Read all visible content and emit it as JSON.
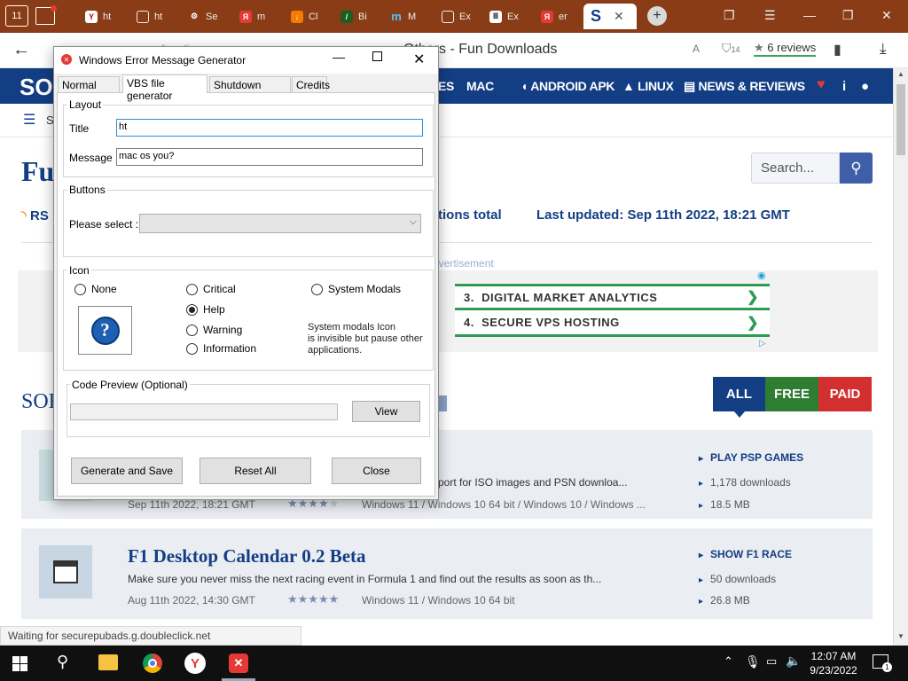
{
  "browser": {
    "tab_count": "11",
    "tabs": [
      "ht",
      "ht",
      "Se",
      "m",
      "Cl",
      "Bi",
      "M",
      "Ex",
      "Ex",
      "er"
    ],
    "address": "softpedia.com",
    "page_title": "Others - Fun Downloads",
    "reviews": "6 reviews",
    "shield_badge": "14"
  },
  "site": {
    "logo": "SO",
    "nav": [
      "ES",
      "MAC",
      "ANDROID APK",
      "LINUX",
      "NEWS & REVIEWS"
    ],
    "subnav_letter": "S",
    "heading": "Fu",
    "search_placeholder": "Search...",
    "rss": "RS",
    "totals": "tions total",
    "last_updated": "Last updated: Sep 11th 2022, 18:21 GMT",
    "advert_label": "Advertisement",
    "ads": [
      {
        "num": "3.",
        "text": "DIGITAL MARKET ANALYTICS"
      },
      {
        "num": "4.",
        "text": "SECURE VPS HOSTING"
      }
    ],
    "sort_label": "SOR",
    "filters": [
      "ALL",
      "FREE",
      "PAID"
    ],
    "items": [
      {
        "title": "",
        "desc": "port for ISO images and PSN downloa...",
        "date": "Sep 11th 2022, 18:21 GMT",
        "rating": 4,
        "platform": "Windows 11 / Windows 10 64 bit / Windows 10 / Windows ...",
        "link": "PLAY PSP GAMES",
        "downloads": "1,178 downloads",
        "size": "18.5 MB"
      },
      {
        "title": "F1 Desktop Calendar 0.2 Beta",
        "desc": "Make sure you never miss the next racing event in Formula 1 and find out the results as soon as th...",
        "date": "Aug 11th 2022, 14:30 GMT",
        "rating": 0,
        "platform": "Windows 11 / Windows 10 64 bit",
        "link": "SHOW F1 RACE",
        "downloads": "50 downloads",
        "size": "26.8 MB"
      }
    ]
  },
  "status_text": "Waiting for securepubads.g.doubleclick.net",
  "taskbar": {
    "time": "12:07 AM",
    "date": "9/23/2022",
    "notif_count": "1"
  },
  "dialog": {
    "title": "Windows Error Message Generator",
    "tabs": [
      "Normal Mode",
      "VBS file generator",
      "Shutdown Dialog",
      "Credits"
    ],
    "layout_group": "Layout",
    "title_label": "Title",
    "title_value": "ht",
    "message_label": "Message",
    "message_value": "mac os you?",
    "buttons_group": "Buttons",
    "please_select": "Please select :",
    "select_value": "",
    "icon_group": "Icon",
    "radios": {
      "none": "None",
      "critical": "Critical",
      "system_modals": "System Modals",
      "help": "Help",
      "warning": "Warning",
      "information": "Information"
    },
    "selected_icon": "help",
    "system_modals_note": [
      "System modals Icon",
      "is invisible but pause other",
      "applications."
    ],
    "code_preview_group": "Code Preview (Optional)",
    "view_button": "View",
    "generate_button": "Generate and Save",
    "reset_button": "Reset All",
    "close_button": "Close"
  },
  "colors": {
    "brand_blue": "#133e84",
    "tab_bar": "#8a3c16",
    "free_green": "#2e7d32",
    "paid_red": "#d32f2f",
    "ad_green": "#2f9b57"
  }
}
